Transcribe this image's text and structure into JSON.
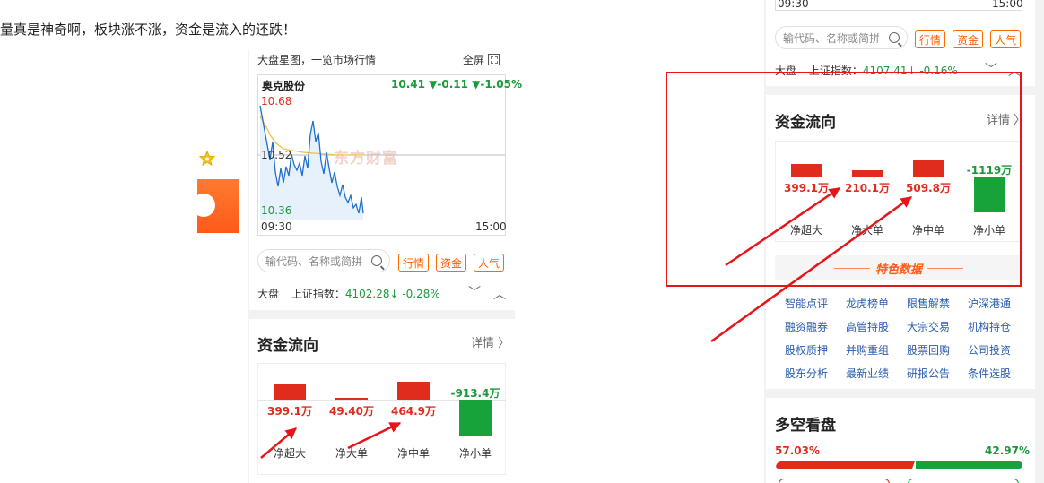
{
  "headline": "量真是神奇啊，板块涨不涨，资金是流入的还跌！",
  "middle": {
    "chart_header": "大盘星图，一览市场行情",
    "fullscreen_label": "全屏",
    "stock_name": "奥克股份",
    "stock_quote": "10.41 ▼-0.11 ▼-1.05%",
    "y_high": "10.68",
    "y_mid": "10.52",
    "y_low": "10.36",
    "x_start": "09:30",
    "x_end": "15:00",
    "watermark": "东方财富",
    "search_placeholder": "输代码、名称或简拼",
    "tags": [
      "行情",
      "资金",
      "人气"
    ],
    "index_label": "大盘",
    "index_text": "上证指数：",
    "index_value": "4102.28↓ -0.28%",
    "flow_title": "资金流向",
    "detail_label": "详情 〉",
    "flow": [
      {
        "label": "净超大",
        "value": "399.1万",
        "amount": 399.1
      },
      {
        "label": "净大单",
        "value": "49.40万",
        "amount": 49.4
      },
      {
        "label": "净中单",
        "value": "464.9万",
        "amount": 464.9
      },
      {
        "label": "净小单",
        "value": "-913.4万",
        "amount": -913.4
      }
    ]
  },
  "right": {
    "x_start": "09:30",
    "x_end": "15:00",
    "search_placeholder": "输代码、名称或简拼",
    "tags": [
      "行情",
      "资金",
      "人气"
    ],
    "index_label": "大盘",
    "index_text": "上证指数：",
    "index_value": "4107.41↓ -0.16%",
    "flow_title": "资金流向",
    "detail_label": "详情 〉",
    "flow": [
      {
        "label": "净超大",
        "value": "399.1万",
        "amount": 399.1
      },
      {
        "label": "净大单",
        "value": "210.1万",
        "amount": 210.1
      },
      {
        "label": "净中单",
        "value": "509.8万",
        "amount": 509.8
      },
      {
        "label": "净小单",
        "value": "-1119万",
        "amount": -1119
      }
    ],
    "feature_title": "特色数据",
    "links": [
      "智能点评",
      "龙虎榜单",
      "限售解禁",
      "沪深港通",
      "融资融券",
      "高管持股",
      "大宗交易",
      "机构持仓",
      "股权质押",
      "并购重组",
      "股票回购",
      "公司投资",
      "股东分析",
      "最新业绩",
      "研报公告",
      "条件选股"
    ],
    "long_short_title": "多空看盘",
    "long_pct": "57.03%",
    "short_pct": "42.97%",
    "long_ratio": 0.5703
  },
  "colors": {
    "up": "#e02c1d",
    "down": "#18a33a",
    "accent": "#ff5a00",
    "annotation": "#e8141a",
    "link": "#2a5db0"
  },
  "icons": {
    "star": "star-icon",
    "fullscreen": "fullscreen-icon",
    "search": "search-icon",
    "chevron_down": "chevron-down-icon",
    "chevron_up": "chevron-up-icon"
  }
}
